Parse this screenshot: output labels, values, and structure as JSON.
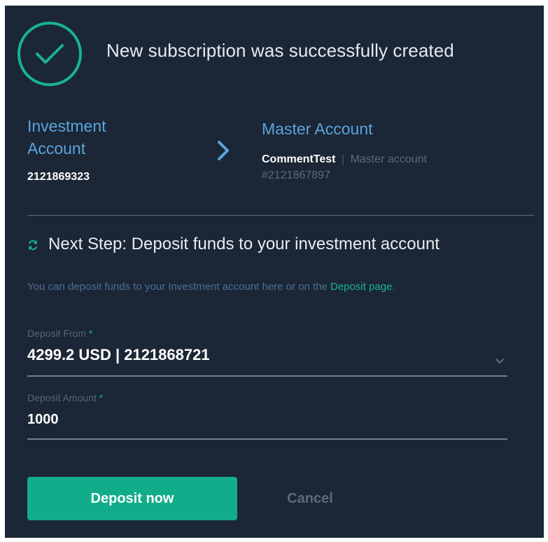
{
  "header": {
    "title": "New subscription was successfully created"
  },
  "investment": {
    "label": "Investment Account",
    "number": "2121869323"
  },
  "master": {
    "label": "Master Account",
    "name": "CommentTest",
    "separator": "|",
    "description": "Master account #2121867897"
  },
  "next_step": {
    "title": "Next Step: Deposit funds to your investment account",
    "hint_prefix": "You can deposit funds to your Investment account here or on the ",
    "hint_link": "Deposit page",
    "hint_suffix": "."
  },
  "form": {
    "deposit_from_label": "Deposit From",
    "deposit_from_value": "4299.2 USD | 2121868721",
    "deposit_amount_label": "Deposit Amount",
    "deposit_amount_value": "1000",
    "required_mark": "*"
  },
  "actions": {
    "deposit_label": "Deposit now",
    "cancel_label": "Cancel"
  },
  "icons": {
    "success": "check-circle-icon",
    "arrow": "chevron-right-icon",
    "sync": "sync-icon",
    "dropdown": "chevron-down-icon"
  },
  "colors": {
    "background": "#1b2636",
    "accent": "#19b394",
    "link_blue": "#5aa5dd",
    "button": "#11ad8a"
  }
}
